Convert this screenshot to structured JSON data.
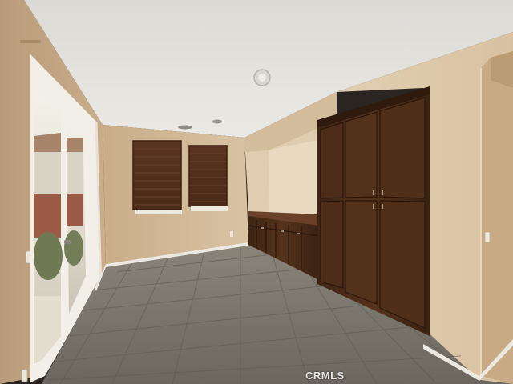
{
  "photo": {
    "watermark": "CRMLS"
  },
  "colors": {
    "wall": "#d6bf9f",
    "ceiling": "#e5e3de",
    "cabinet": "#4a2c18",
    "floor": "#747068",
    "baseboard": "#ece9e2"
  }
}
